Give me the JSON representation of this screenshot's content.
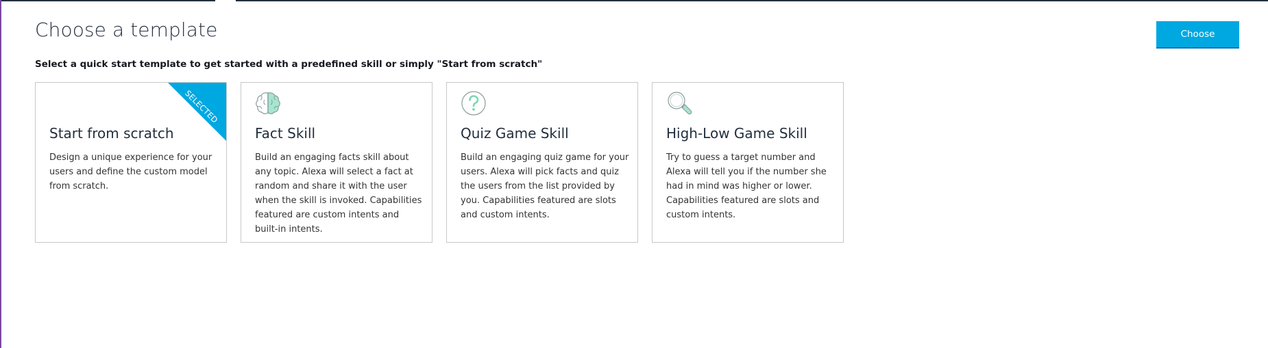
{
  "header": {
    "title": "Choose a template",
    "subtitle": "Select a quick start template to get started with a predefined skill or simply \"Start from scratch\"",
    "choose_label": "Choose"
  },
  "colors": {
    "accent": "#00a8e1",
    "icon_fill": "#a5e6cf",
    "icon_stroke": "#8a9a9a"
  },
  "templates": [
    {
      "name": "Start from scratch",
      "description": "Design a unique experience for your users and define the custom model from scratch.",
      "selected": true,
      "ribbon": "SELECTED",
      "icon": ""
    },
    {
      "name": "Fact Skill",
      "description": "Build an engaging facts skill about any topic. Alexa will select a fact at random and share it with the user when the skill is invoked. Capabilities featured are custom intents and built-in intents.",
      "selected": false,
      "icon": "brain-icon"
    },
    {
      "name": "Quiz Game Skill",
      "description": "Build an engaging quiz game for your users. Alexa will pick facts and quiz the users from the list provided by you. Capabilities featured are slots and custom intents.",
      "selected": false,
      "icon": "question-mark-icon"
    },
    {
      "name": "High-Low Game Skill",
      "description": "Try to guess a target number and Alexa will tell you if the number she had in mind was higher or lower. Capabilities featured are slots and custom intents.",
      "selected": false,
      "icon": "magnifier-icon"
    }
  ]
}
